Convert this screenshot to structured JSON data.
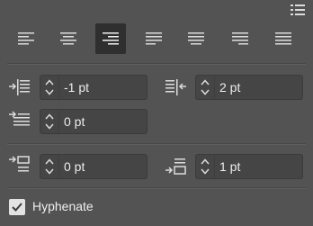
{
  "panel": {
    "alignment_options": [
      {
        "name": "align-left-icon",
        "active": false
      },
      {
        "name": "align-center-icon",
        "active": false
      },
      {
        "name": "align-right-icon",
        "active": true
      },
      {
        "name": "justify-last-left-icon",
        "active": false
      },
      {
        "name": "justify-last-center-icon",
        "active": false
      },
      {
        "name": "justify-last-right-icon",
        "active": false
      },
      {
        "name": "justify-all-icon",
        "active": false
      }
    ],
    "left_indent": {
      "value": "-1 pt"
    },
    "right_indent": {
      "value": "2 pt"
    },
    "first_line_indent": {
      "value": "0 pt"
    },
    "space_before": {
      "value": "0 pt"
    },
    "space_after": {
      "value": "1 pt"
    },
    "hyphenate": {
      "label": "Hyphenate",
      "checked": true
    }
  },
  "colors": {
    "background": "#535353",
    "field": "#454545",
    "active_button": "#2f2f2f",
    "icon": "#dcdcdc"
  }
}
